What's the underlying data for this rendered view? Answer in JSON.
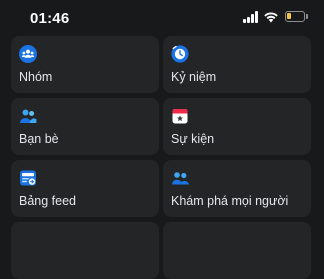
{
  "status_bar": {
    "time": "01:46",
    "battery_level": 0.25,
    "battery_color": "#f6c344"
  },
  "menu": {
    "items": [
      {
        "label": "Nhóm",
        "icon": "groups-icon"
      },
      {
        "label": "Kỷ niệm",
        "icon": "memories-clock-icon"
      },
      {
        "label": "Bạn bè",
        "icon": "friends-icon"
      },
      {
        "label": "Sự kiện",
        "icon": "events-calendar-icon"
      },
      {
        "label": "Bảng feed",
        "icon": "feeds-icon"
      },
      {
        "label": "Khám phá mọi người",
        "icon": "find-people-icon"
      }
    ]
  },
  "colors": {
    "background": "#18191a",
    "card": "#242526",
    "accent_blue": "#1b74e4"
  }
}
